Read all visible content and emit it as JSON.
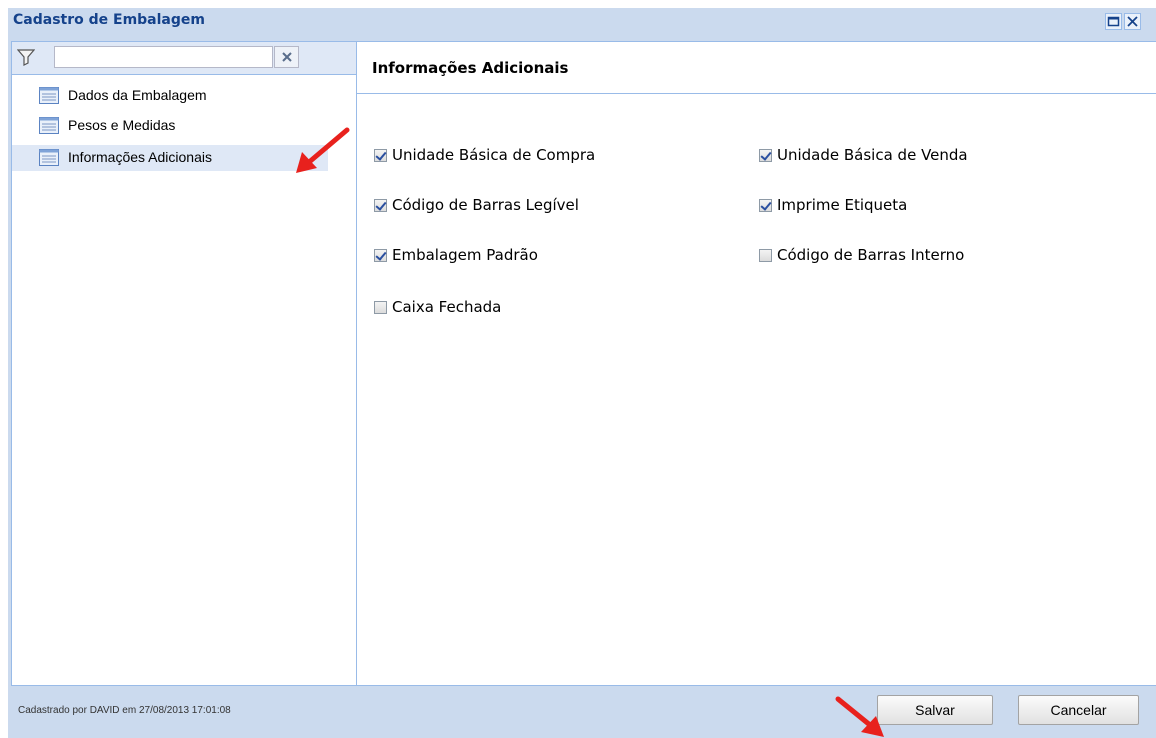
{
  "window": {
    "title": "Cadastro de Embalagem",
    "maximize_icon": "maximize-icon",
    "close_icon": "close-icon"
  },
  "sidebar": {
    "filter": {
      "icon": "filter-icon",
      "value": "",
      "placeholder": "",
      "clear_icon": "clear-x-icon"
    },
    "items": [
      {
        "label": "Dados da Embalagem",
        "icon": "list-icon",
        "selected": false
      },
      {
        "label": "Pesos e Medidas",
        "icon": "list-icon",
        "selected": false
      },
      {
        "label": "Informações Adicionais",
        "icon": "list-icon",
        "selected": true
      }
    ]
  },
  "main": {
    "section_title": "Informações Adicionais",
    "options": [
      {
        "label": "Unidade Básica de Compra",
        "checked": true
      },
      {
        "label": "Unidade Básica de Venda",
        "checked": true
      },
      {
        "label": "Código de Barras Legível",
        "checked": true
      },
      {
        "label": "Imprime Etiqueta",
        "checked": true
      },
      {
        "label": "Embalagem Padrão",
        "checked": true
      },
      {
        "label": "Código de Barras Interno",
        "checked": false
      },
      {
        "label": "Caixa Fechada",
        "checked": false
      }
    ]
  },
  "footer": {
    "status": "Cadastrado por DAVID em 27/08/2013 17:01:08",
    "save_label": "Salvar",
    "cancel_label": "Cancelar"
  },
  "colors": {
    "window_bg": "#cbdaee",
    "title_text": "#15428b",
    "border": "#99bbe8",
    "selected_row": "#dfe8f6",
    "annotation_arrow": "#e8211d"
  }
}
